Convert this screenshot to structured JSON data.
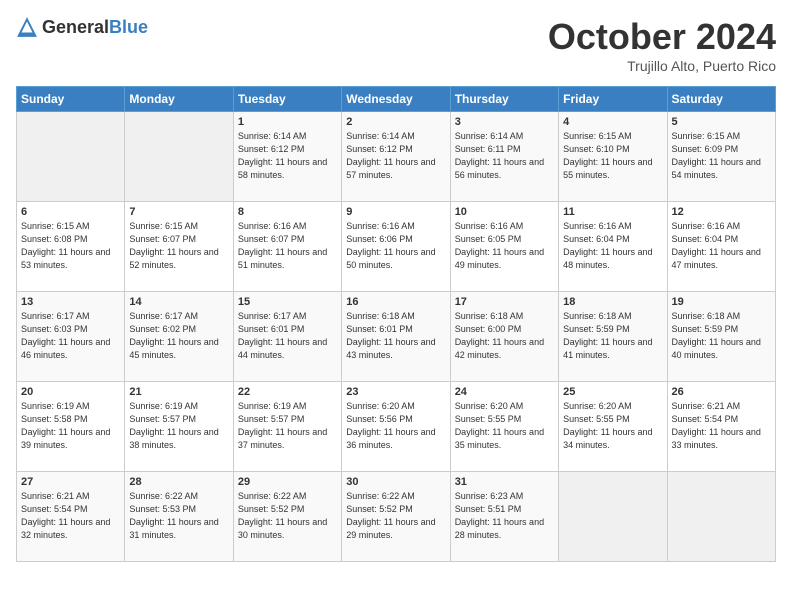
{
  "header": {
    "logo_general": "General",
    "logo_blue": "Blue",
    "month_title": "October 2024",
    "location": "Trujillo Alto, Puerto Rico"
  },
  "days_of_week": [
    "Sunday",
    "Monday",
    "Tuesday",
    "Wednesday",
    "Thursday",
    "Friday",
    "Saturday"
  ],
  "weeks": [
    [
      {
        "day": "",
        "info": ""
      },
      {
        "day": "",
        "info": ""
      },
      {
        "day": "1",
        "info": "Sunrise: 6:14 AM\nSunset: 6:12 PM\nDaylight: 11 hours and 58 minutes."
      },
      {
        "day": "2",
        "info": "Sunrise: 6:14 AM\nSunset: 6:12 PM\nDaylight: 11 hours and 57 minutes."
      },
      {
        "day": "3",
        "info": "Sunrise: 6:14 AM\nSunset: 6:11 PM\nDaylight: 11 hours and 56 minutes."
      },
      {
        "day": "4",
        "info": "Sunrise: 6:15 AM\nSunset: 6:10 PM\nDaylight: 11 hours and 55 minutes."
      },
      {
        "day": "5",
        "info": "Sunrise: 6:15 AM\nSunset: 6:09 PM\nDaylight: 11 hours and 54 minutes."
      }
    ],
    [
      {
        "day": "6",
        "info": "Sunrise: 6:15 AM\nSunset: 6:08 PM\nDaylight: 11 hours and 53 minutes."
      },
      {
        "day": "7",
        "info": "Sunrise: 6:15 AM\nSunset: 6:07 PM\nDaylight: 11 hours and 52 minutes."
      },
      {
        "day": "8",
        "info": "Sunrise: 6:16 AM\nSunset: 6:07 PM\nDaylight: 11 hours and 51 minutes."
      },
      {
        "day": "9",
        "info": "Sunrise: 6:16 AM\nSunset: 6:06 PM\nDaylight: 11 hours and 50 minutes."
      },
      {
        "day": "10",
        "info": "Sunrise: 6:16 AM\nSunset: 6:05 PM\nDaylight: 11 hours and 49 minutes."
      },
      {
        "day": "11",
        "info": "Sunrise: 6:16 AM\nSunset: 6:04 PM\nDaylight: 11 hours and 48 minutes."
      },
      {
        "day": "12",
        "info": "Sunrise: 6:16 AM\nSunset: 6:04 PM\nDaylight: 11 hours and 47 minutes."
      }
    ],
    [
      {
        "day": "13",
        "info": "Sunrise: 6:17 AM\nSunset: 6:03 PM\nDaylight: 11 hours and 46 minutes."
      },
      {
        "day": "14",
        "info": "Sunrise: 6:17 AM\nSunset: 6:02 PM\nDaylight: 11 hours and 45 minutes."
      },
      {
        "day": "15",
        "info": "Sunrise: 6:17 AM\nSunset: 6:01 PM\nDaylight: 11 hours and 44 minutes."
      },
      {
        "day": "16",
        "info": "Sunrise: 6:18 AM\nSunset: 6:01 PM\nDaylight: 11 hours and 43 minutes."
      },
      {
        "day": "17",
        "info": "Sunrise: 6:18 AM\nSunset: 6:00 PM\nDaylight: 11 hours and 42 minutes."
      },
      {
        "day": "18",
        "info": "Sunrise: 6:18 AM\nSunset: 5:59 PM\nDaylight: 11 hours and 41 minutes."
      },
      {
        "day": "19",
        "info": "Sunrise: 6:18 AM\nSunset: 5:59 PM\nDaylight: 11 hours and 40 minutes."
      }
    ],
    [
      {
        "day": "20",
        "info": "Sunrise: 6:19 AM\nSunset: 5:58 PM\nDaylight: 11 hours and 39 minutes."
      },
      {
        "day": "21",
        "info": "Sunrise: 6:19 AM\nSunset: 5:57 PM\nDaylight: 11 hours and 38 minutes."
      },
      {
        "day": "22",
        "info": "Sunrise: 6:19 AM\nSunset: 5:57 PM\nDaylight: 11 hours and 37 minutes."
      },
      {
        "day": "23",
        "info": "Sunrise: 6:20 AM\nSunset: 5:56 PM\nDaylight: 11 hours and 36 minutes."
      },
      {
        "day": "24",
        "info": "Sunrise: 6:20 AM\nSunset: 5:55 PM\nDaylight: 11 hours and 35 minutes."
      },
      {
        "day": "25",
        "info": "Sunrise: 6:20 AM\nSunset: 5:55 PM\nDaylight: 11 hours and 34 minutes."
      },
      {
        "day": "26",
        "info": "Sunrise: 6:21 AM\nSunset: 5:54 PM\nDaylight: 11 hours and 33 minutes."
      }
    ],
    [
      {
        "day": "27",
        "info": "Sunrise: 6:21 AM\nSunset: 5:54 PM\nDaylight: 11 hours and 32 minutes."
      },
      {
        "day": "28",
        "info": "Sunrise: 6:22 AM\nSunset: 5:53 PM\nDaylight: 11 hours and 31 minutes."
      },
      {
        "day": "29",
        "info": "Sunrise: 6:22 AM\nSunset: 5:52 PM\nDaylight: 11 hours and 30 minutes."
      },
      {
        "day": "30",
        "info": "Sunrise: 6:22 AM\nSunset: 5:52 PM\nDaylight: 11 hours and 29 minutes."
      },
      {
        "day": "31",
        "info": "Sunrise: 6:23 AM\nSunset: 5:51 PM\nDaylight: 11 hours and 28 minutes."
      },
      {
        "day": "",
        "info": ""
      },
      {
        "day": "",
        "info": ""
      }
    ]
  ]
}
